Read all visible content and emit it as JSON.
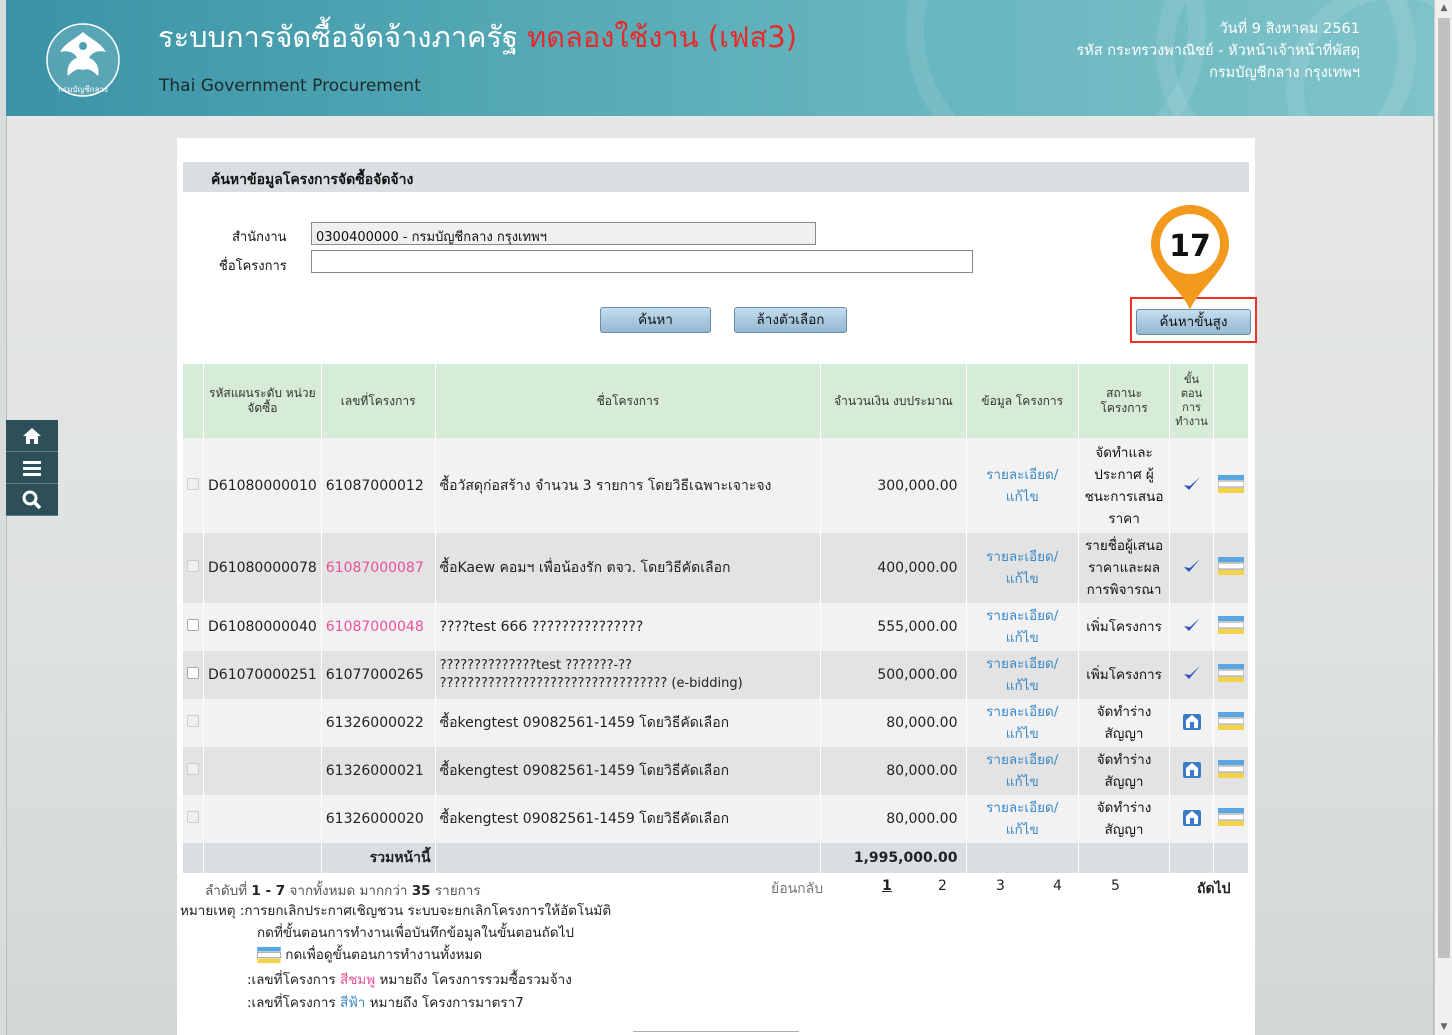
{
  "header": {
    "title": "ระบบการจัดซื้อจัดจ้างภาครัฐ",
    "trial": "ทดลองใช้งาน (เฟส3)",
    "subtitle": "Thai Government Procurement",
    "date": "วันที่ 9 สิงหาคม 2561",
    "user": "รหัส กระทรวงพาณิชย์ - หัวหน้าเจ้าหน้าที่พัสดุ",
    "office": "กรมบัญชีกลาง กรุงเทพฯ",
    "logo_text": "กรมบัญชีกลาง"
  },
  "sidebar": {
    "home": "home-icon",
    "menu": "menu-icon",
    "search": "search-icon"
  },
  "search": {
    "section_title": "ค้นหาข้อมูลโครงการจัดซื้อจัดจ้าง",
    "office_label": "สำนักงาน",
    "office_value": "0300400000 - กรมบัญชีกลาง กรุงเทพฯ",
    "project_label": "ชื่อโครงการ",
    "project_value": "",
    "search_button": "ค้นหา",
    "clear_button": "ล้างตัวเลือก",
    "advanced_button": "ค้นหาขั้นสูง",
    "step_marker": "17"
  },
  "table": {
    "headers": {
      "plan_code": "รหัสแผนระดับ หน่วยจัดซื้อ",
      "project_no": "เลขที่โครงการ",
      "project_name": "ชื่อโครงการ",
      "budget": "จำนวนเงิน งบประมาณ",
      "info": "ข้อมูล โครงการ",
      "status": "สถานะ โครงการ",
      "steps": "ขั้น ตอน การ ทำงาน"
    },
    "rows": [
      {
        "plan": "D61080000010",
        "no": "61087000012",
        "name": "ซื้อวัสดุก่อสร้าง จำนวน 3 รายการ โดยวิธีเฉพาะเจาะจง",
        "budget": "300,000.00",
        "link": "รายละเอียด/แก้ไข",
        "status": "จัดทำและประกาศ ผู้ชนะการเสนอราคา"
      },
      {
        "plan": "D61080000078",
        "no": "61087000087",
        "name": "ซื้อKaew คอมฯ เพื่อน้องรัก ตจว. โดยวิธีคัดเลือก",
        "budget": "400,000.00",
        "link": "รายละเอียด/แก้ไข",
        "status": "รายชื่อผู้เสนอราคาและผลการพิจารณา"
      },
      {
        "plan": "D61080000040",
        "no": "61087000048",
        "name": "????test 666 ???????????????",
        "budget": "555,000.00",
        "link": "รายละเอียด/แก้ไข",
        "status": "เพิ่มโครงการ"
      },
      {
        "plan": "D61070000251",
        "no": "61077000265",
        "name": "??????????????test ???????-?? ????????????????????????????????? (e-bidding)",
        "budget": "500,000.00",
        "link": "รายละเอียด/แก้ไข",
        "status": "เพิ่มโครงการ"
      },
      {
        "plan": "",
        "no": "61326000022",
        "name": "ซื้อkengtest 09082561-1459 โดยวิธีคัดเลือก",
        "budget": "80,000.00",
        "link": "รายละเอียด/แก้ไข",
        "status": "จัดทำร่างสัญญา"
      },
      {
        "plan": "",
        "no": "61326000021",
        "name": "ซื้อkengtest 09082561-1459 โดยวิธีคัดเลือก",
        "budget": "80,000.00",
        "link": "รายละเอียด/แก้ไข",
        "status": "จัดทำร่างสัญญา"
      },
      {
        "plan": "",
        "no": "61326000020",
        "name": "ซื้อkengtest 09082561-1459 โดยวิธีคัดเลือก",
        "budget": "80,000.00",
        "link": "รายละเอียด/แก้ไข",
        "status": "จัดทำร่างสัญญา"
      }
    ],
    "total_label": "รวมหน้านี้",
    "total_value": "1,995,000.00"
  },
  "pagination": {
    "summary_prefix": "ลำดับที่",
    "range": "1 - 7",
    "summary_mid": "จากทั้งหมด มากกว่า",
    "count": "35",
    "summary_suffix": "รายการ",
    "back": "ย้อนกลับ",
    "pages": [
      "1",
      "2",
      "3",
      "4",
      "5"
    ],
    "next": "ถัดไป"
  },
  "notes": {
    "line1": "หมายเหตุ :การยกเลิกประกาศเชิญชวน ระบบจะยกเลิกโครงการให้อัตโนมัติ",
    "line2": "กดที่ขั้นตอนการทำงานเพื่อบันทึกข้อมูลในขั้นตอนถัดไป",
    "line3": "กดเพื่อดูขั้นตอนการทำงานทั้งหมด",
    "line4_prefix": ":เลขที่โครงการ",
    "line4_color": "สีชมพู",
    "line4_suffix": "หมายถึง โครงการรวมซื้อรวมจ้าง",
    "line5_prefix": ":เลขที่โครงการ",
    "line5_color": "สีฟ้า",
    "line5_suffix": "หมายถึง โครงการมาตรา7"
  },
  "colors": {
    "header": "#4ea3b1",
    "trial_text": "#e82a2a",
    "pink_project": "#e8529a",
    "blue_project": "#3b8ac7",
    "marker": "#f39a1e"
  }
}
